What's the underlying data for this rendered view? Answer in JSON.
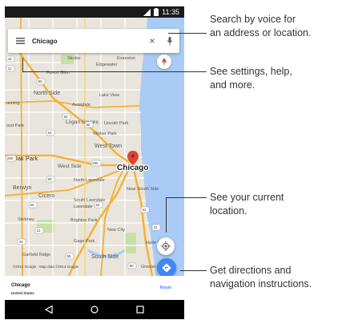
{
  "statusbar": {
    "time": "11:35"
  },
  "search": {
    "query": "Chicago",
    "clear_glyph": "×"
  },
  "map": {
    "city_label": "Chicago",
    "neighborhoods": [
      "Lake View",
      "North Side",
      "Avondale",
      "Lincoln Park",
      "Logan Square",
      "Wicker Park",
      "West Town",
      "West Side",
      "North Lawndale",
      "South Lawndale",
      "Lawndale",
      "Near South Side",
      "Oak Park",
      "Berwyn",
      "Cicero",
      "Stickney",
      "Brighton Park",
      "New City",
      "Garfield Ridge",
      "Gage Park",
      "South Side",
      "Hyde Pa",
      "Greater Gr",
      "Edgewater",
      "Forest Glen",
      "Evanston",
      "unning",
      "ood Park",
      "Skokie"
    ],
    "road_shields": [
      "43",
      "41",
      "90",
      "94",
      "90",
      "64",
      "290",
      "290",
      "50",
      "64",
      "50",
      "41",
      "12",
      "43",
      "55",
      "41",
      "90"
    ]
  },
  "copyright": "©2014 Google · Map data ©2014 Google",
  "place_card": {
    "name": "Chicago",
    "subtitle": "United States",
    "route_label": "Route"
  },
  "callouts": [
    {
      "line1": "Search by voice for",
      "line2": "an address or location."
    },
    {
      "line1": "See settings, help,",
      "line2": "and more."
    },
    {
      "line1": "See your current",
      "line2": "location."
    },
    {
      "line1": "Get directions and",
      "line2": "navigation instructions."
    }
  ],
  "colors": {
    "map_bg": "#e9e5dc",
    "water": "#a9cbf5",
    "park": "#c8dfa8",
    "highway": "#f4b13a",
    "accent": "#4285f4",
    "pin": "#db4437"
  },
  "icons": [
    "signal-icon",
    "battery-icon",
    "menu-icon",
    "microphone-icon",
    "close-icon",
    "compass-icon",
    "my-location-icon",
    "directions-icon",
    "back-icon",
    "home-icon",
    "recents-icon"
  ]
}
